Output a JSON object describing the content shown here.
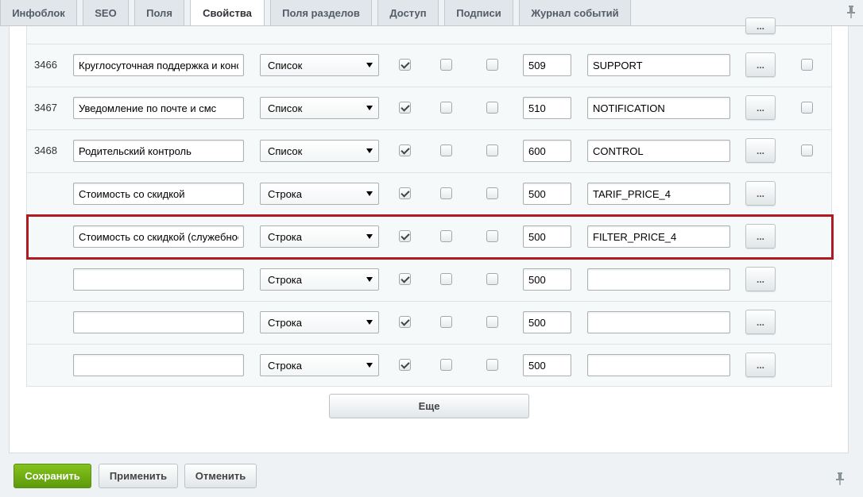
{
  "tabs": [
    {
      "label": "Инфоблок",
      "active": false
    },
    {
      "label": "SEO",
      "active": false
    },
    {
      "label": "Поля",
      "active": false
    },
    {
      "label": "Свойства",
      "active": true
    },
    {
      "label": "Поля разделов",
      "active": false
    },
    {
      "label": "Доступ",
      "active": false
    },
    {
      "label": "Подписи",
      "active": false
    },
    {
      "label": "Журнал событий",
      "active": false
    }
  ],
  "properties": [
    {
      "id": "3466",
      "name": "Круглосуточная поддержка и консультации",
      "type": "Список",
      "active": true,
      "multiple": false,
      "required": false,
      "sort": "509",
      "code": "SUPPORT",
      "button": "...",
      "has_delete": true
    },
    {
      "id": "3467",
      "name": "Уведомление по почте и смс",
      "type": "Список",
      "active": true,
      "multiple": false,
      "required": false,
      "sort": "510",
      "code": "NOTIFICATION",
      "button": "...",
      "has_delete": true
    },
    {
      "id": "3468",
      "name": "Родительский контроль",
      "type": "Список",
      "active": true,
      "multiple": false,
      "required": false,
      "sort": "600",
      "code": "CONTROL",
      "button": "...",
      "has_delete": true
    },
    {
      "id": "",
      "name": "Стоимость со скидкой",
      "type": "Строка",
      "active": true,
      "multiple": false,
      "required": false,
      "sort": "500",
      "code": "TARIF_PRICE_4",
      "button": "...",
      "has_delete": false
    },
    {
      "id": "",
      "name": "Стоимость со скидкой (служебное)",
      "type": "Строка",
      "active": true,
      "multiple": false,
      "required": false,
      "sort": "500",
      "code": "FILTER_PRICE_4",
      "button": "...",
      "has_delete": false
    },
    {
      "id": "",
      "name": "",
      "type": "Строка",
      "active": true,
      "multiple": false,
      "required": false,
      "sort": "500",
      "code": "",
      "button": "...",
      "has_delete": false
    },
    {
      "id": "",
      "name": "",
      "type": "Строка",
      "active": true,
      "multiple": false,
      "required": false,
      "sort": "500",
      "code": "",
      "button": "...",
      "has_delete": false
    },
    {
      "id": "",
      "name": "",
      "type": "Строка",
      "active": true,
      "multiple": false,
      "required": false,
      "sort": "500",
      "code": "",
      "button": "...",
      "has_delete": false
    }
  ],
  "more_button": "Еще",
  "partial_row_button": "...",
  "footer": {
    "save": "Сохранить",
    "apply": "Применить",
    "cancel": "Отменить"
  },
  "colors": {
    "highlight": "#b01a20",
    "save_button": "#6aa813"
  },
  "icons": [
    "pin-icon",
    "chevron-down-icon",
    "checkmark-icon"
  ]
}
